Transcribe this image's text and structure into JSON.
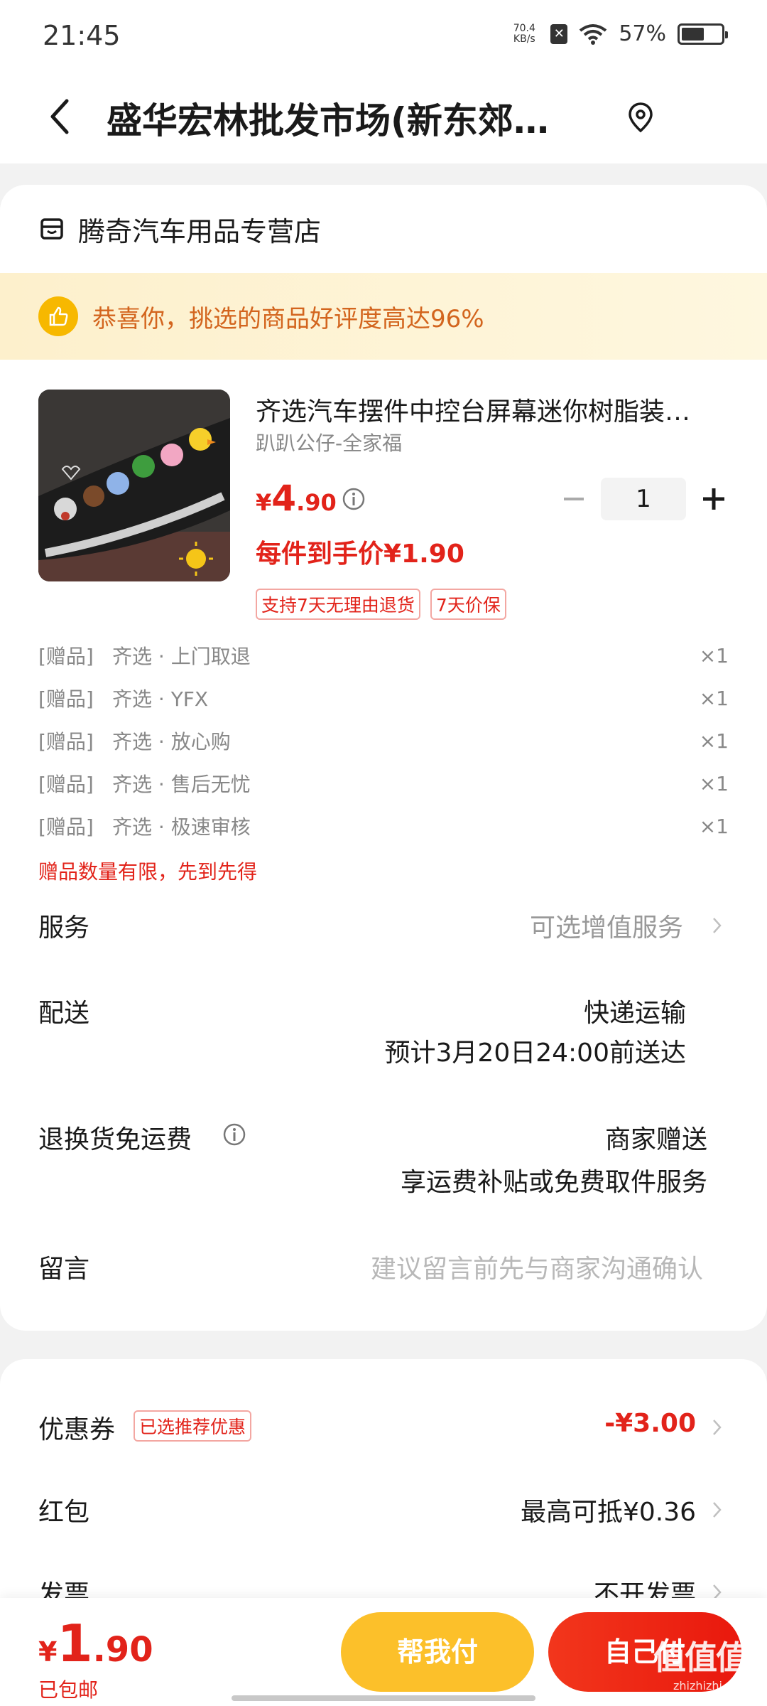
{
  "status_bar": {
    "time": "21:45",
    "net_speed_value": "70.4",
    "net_speed_unit": "KB/s",
    "battery_percent": "57%",
    "battery_level": 0.57
  },
  "header": {
    "title": "盛华宏林批发市场(新东郊…"
  },
  "shop": {
    "name": "腾奇汽车用品专营店"
  },
  "banner": {
    "text": "恭喜你，挑选的商品好评度高达96%"
  },
  "product": {
    "title": "齐选汽车摆件中控台屏幕迷你树脂装…",
    "spec": "趴趴公仔-全家福",
    "price_symbol": "¥",
    "price_int": "4",
    "price_dec": ".90",
    "final_price": "每件到手价¥1.90",
    "tags": [
      "支持7天无理由退货",
      "7天价保"
    ],
    "quantity": "1"
  },
  "gifts": {
    "items": [
      {
        "tag": "[赠品]",
        "name": "齐选 · 上门取退",
        "qty": "×1"
      },
      {
        "tag": "[赠品]",
        "name": "齐选 · YFX",
        "qty": "×1"
      },
      {
        "tag": "[赠品]",
        "name": "齐选 · 放心购",
        "qty": "×1"
      },
      {
        "tag": "[赠品]",
        "name": "齐选 · 售后无忧",
        "qty": "×1"
      },
      {
        "tag": "[赠品]",
        "name": "齐选 · 极速审核",
        "qty": "×1"
      }
    ],
    "note": "赠品数量有限，先到先得"
  },
  "service": {
    "label": "服务",
    "value": "可选增值服务"
  },
  "delivery": {
    "label": "配送",
    "method": "快递运输",
    "eta": "预计3月20日24:00前送达"
  },
  "return_shipping": {
    "label": "退换货免运费",
    "value": "商家赠送",
    "detail": "享运费补贴或免费取件服务"
  },
  "message": {
    "label": "留言",
    "placeholder": "建议留言前先与商家沟通确认"
  },
  "coupon": {
    "label": "优惠券",
    "badge": "已选推荐优惠",
    "value": "-¥3.00"
  },
  "red_packet": {
    "label": "红包",
    "value": "最高可抵¥0.36"
  },
  "invoice": {
    "label": "发票",
    "value": "不开发票"
  },
  "footer": {
    "total_symbol": "¥",
    "total_int": "1",
    "total_dec": ".90",
    "shipping": "已包邮",
    "pay_friend": "帮我付",
    "pay_self": "自己付",
    "watermark": "值值值",
    "watermark_sub": "zhizhizhi.com"
  },
  "colors": {
    "accent_red": "#e2231a",
    "banner_orange": "#d3651e",
    "pay_friend_yellow": "#fcc02a"
  }
}
